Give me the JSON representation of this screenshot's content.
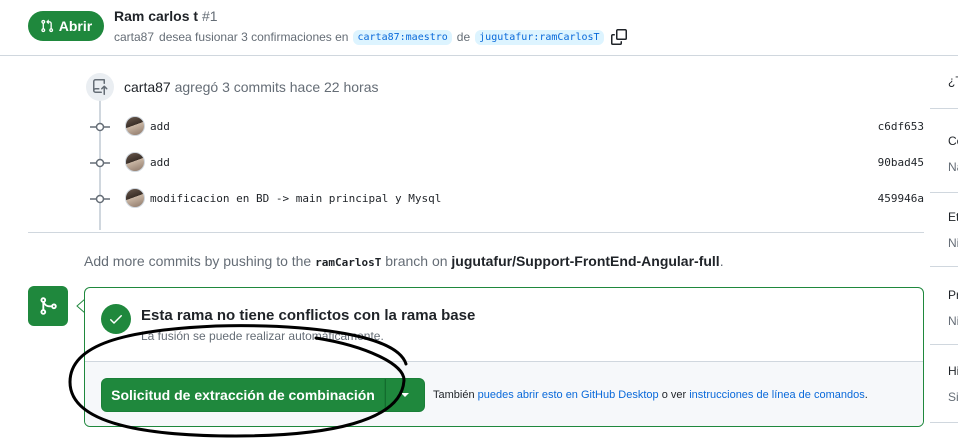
{
  "header": {
    "state_label": "Abrir",
    "title": "Ram carlos t",
    "number": "#1",
    "author": "carta87",
    "merge_text": "desea fusionar 3 confirmaciones en",
    "base_branch": "carta87:maestro",
    "from_text": "de",
    "head_branch": "jugutafur:ramCarlosT"
  },
  "timeline": {
    "event_author": "carta87",
    "event_text": "agregó 3 commits hace 22 horas",
    "commits": [
      {
        "message": "add",
        "sha": "c6df653"
      },
      {
        "message": "add",
        "sha": "90bad45"
      },
      {
        "message": "modificacion en BD -> main principal y Mysql",
        "sha": "459946a"
      }
    ]
  },
  "push_info": {
    "prefix": "Add more commits by pushing to the",
    "branch": "ramCarlosT",
    "middle": "branch on",
    "repo": "jugutafur/Support-FrontEnd-Angular-full",
    "suffix": "."
  },
  "merge": {
    "status_title": "Esta rama no tiene conflictos con la rama base",
    "status_sub": "La fusión se puede realizar automáticamente.",
    "button_label": "Solicitud de extracción de combinación",
    "also_prefix": "También",
    "desktop_link": "puedes abrir esto en GitHub Desktop",
    "or_text": "o ver",
    "cli_link": "instrucciones de línea de comandos",
    "end": "."
  },
  "sidebar": {
    "items": [
      {
        "label": "¿T",
        "value": ""
      },
      {
        "label": "Ce",
        "value": "Na"
      },
      {
        "label": "Et",
        "value": "Ni"
      },
      {
        "label": "Pr",
        "value": "Ni"
      },
      {
        "label": "Hi",
        "value": "Sin"
      }
    ]
  },
  "colors": {
    "accent_green": "#1f883d",
    "link_blue": "#0969da"
  }
}
